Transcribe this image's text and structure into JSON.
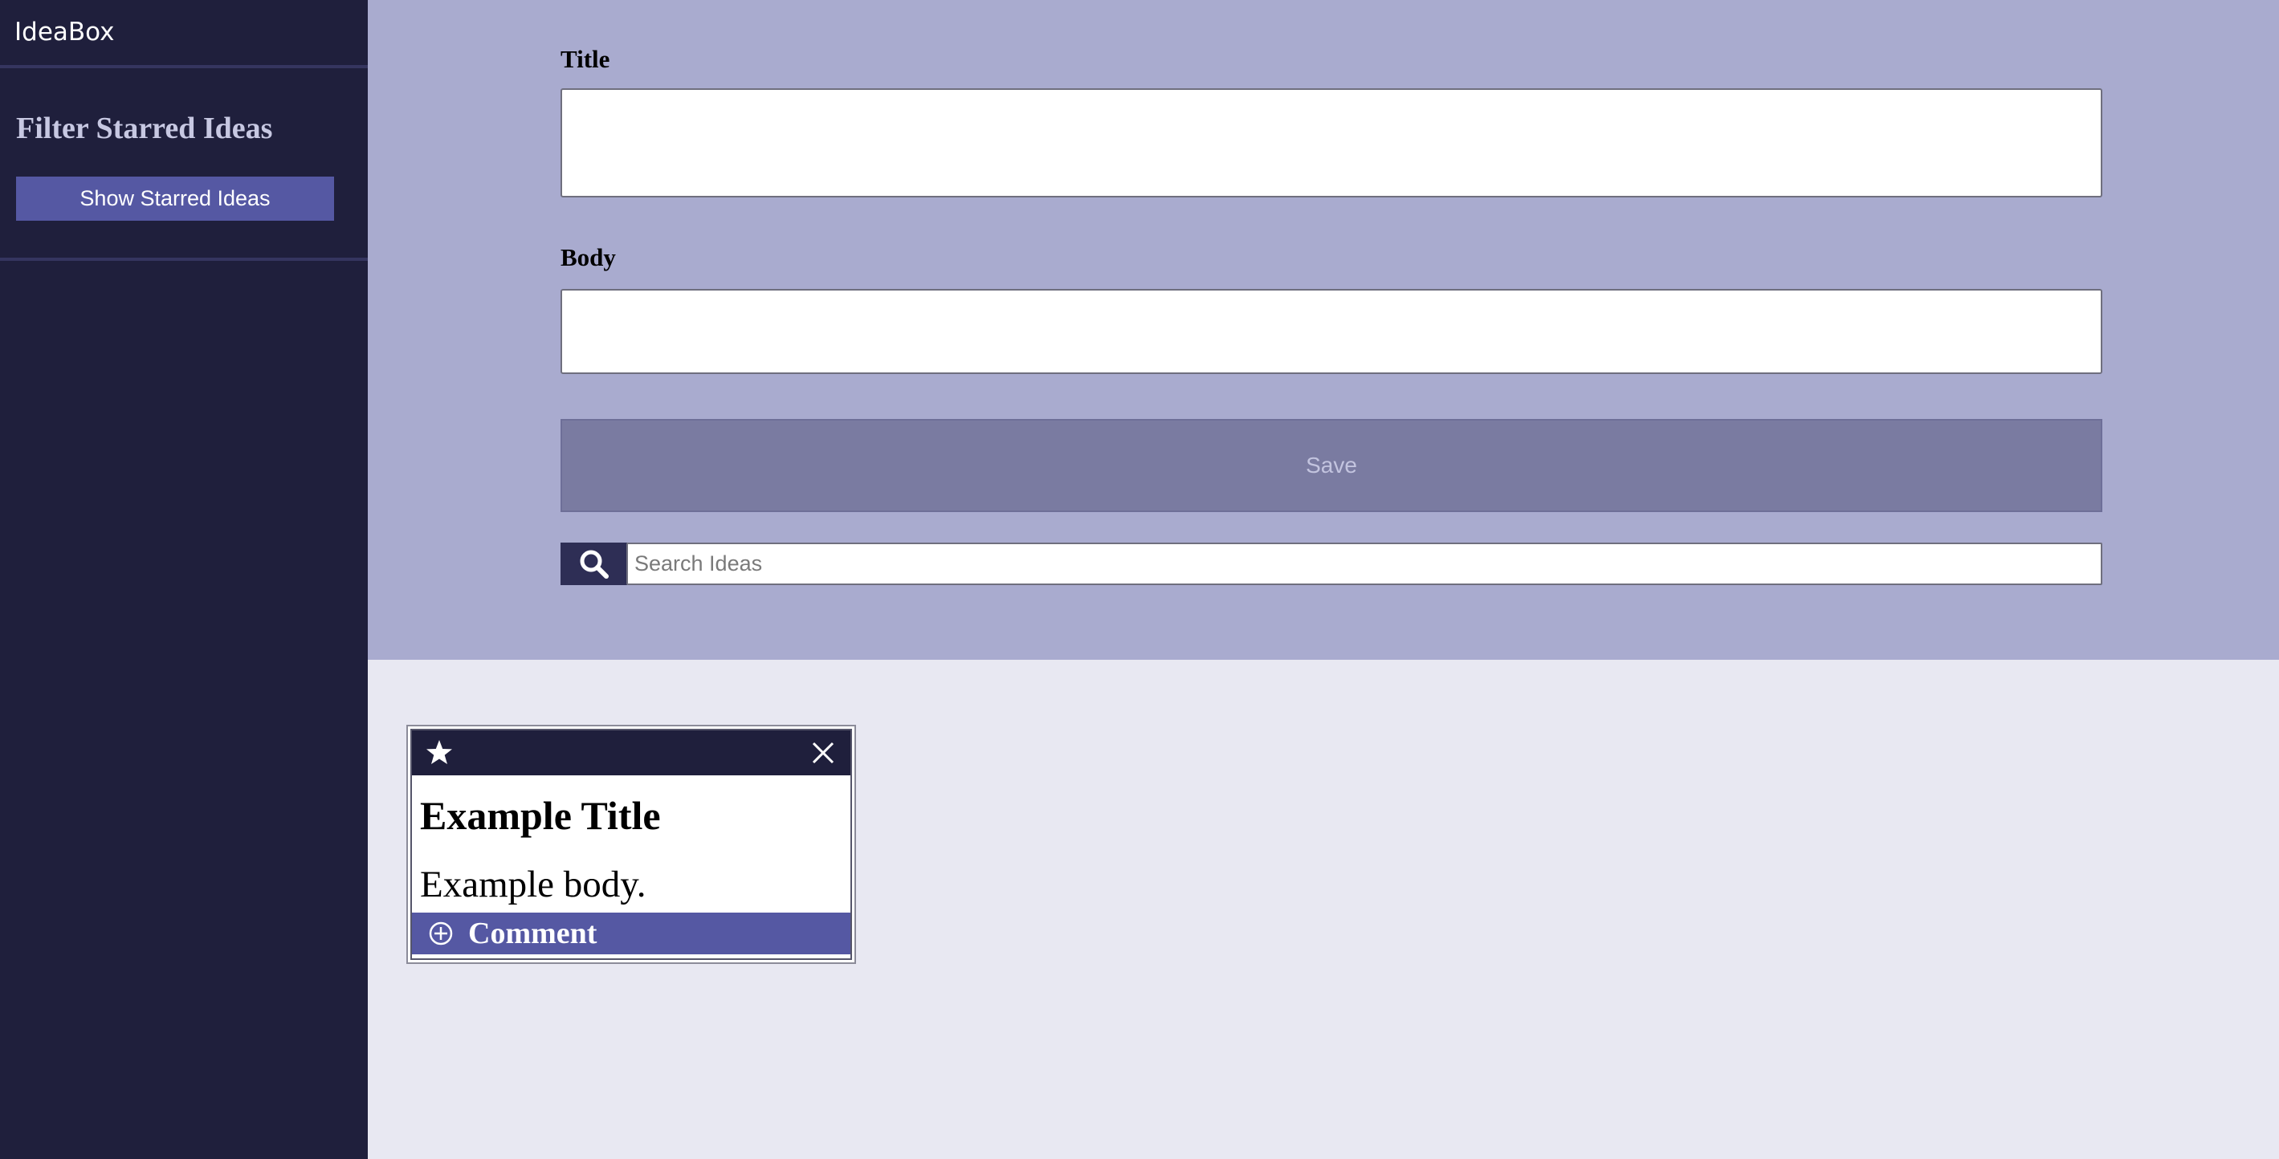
{
  "app": {
    "brand": "IdeaBox"
  },
  "sidebar": {
    "filter_heading": "Filter Starred Ideas",
    "show_starred_label": "Show Starred Ideas"
  },
  "form": {
    "title_label": "Title",
    "title_value": "",
    "body_label": "Body",
    "body_value": "",
    "save_label": "Save",
    "search_placeholder": "Search Ideas",
    "search_icon": "search-icon"
  },
  "ideas": [
    {
      "title": "Example Title",
      "body": "Example body.",
      "comment_label": "Comment",
      "icons": {
        "star": "star-icon",
        "close": "close-icon",
        "comment": "plus-circle-icon"
      }
    }
  ],
  "colors": {
    "sidebar_bg": "#1f1f3c",
    "form_panel_bg": "#a9abcf",
    "page_bg": "#e8e8f2",
    "accent": "#5558a3",
    "save_button_bg": "#7a7ba1",
    "search_button_bg": "#2e2e55"
  }
}
